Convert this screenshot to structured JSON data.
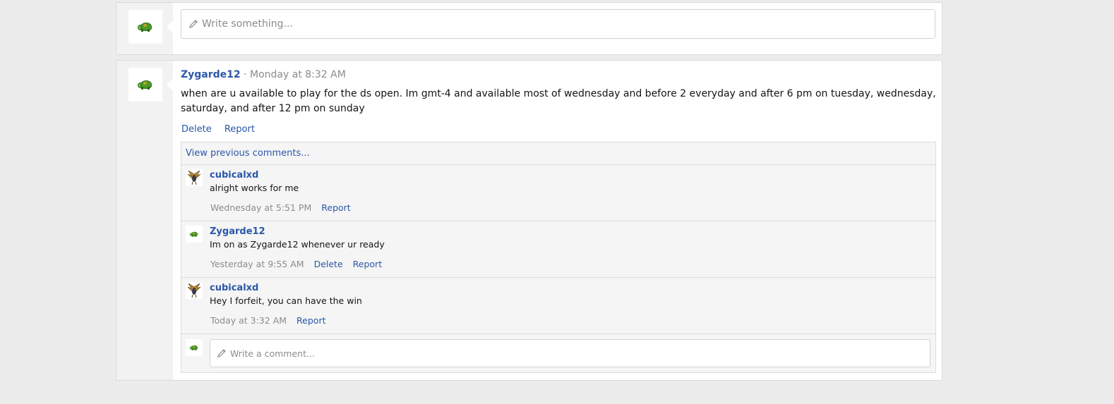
{
  "composer": {
    "placeholder": "Write something..."
  },
  "post": {
    "author": "Zygarde12",
    "separator": " · ",
    "time": "Monday at 8:32 AM",
    "body": "when are u available to play for the ds open. Im gmt-4 and available most of wednesday and before 2 everyday and after 6 pm on tuesday, wednesday, saturday, and after 12 pm on sunday",
    "actions": {
      "delete": "Delete",
      "report": "Report"
    }
  },
  "comments": {
    "view_previous": "View previous comments...",
    "items": [
      {
        "author": "cubicalxd",
        "avatar": "bird-avatar",
        "text": "alright works for me",
        "time": "Wednesday at 5:51 PM",
        "delete": "",
        "report": "Report"
      },
      {
        "author": "Zygarde12",
        "avatar": "turtle-avatar",
        "text": "Im on as Zygarde12 whenever ur ready",
        "time": "Yesterday at 9:55 AM",
        "delete": "Delete",
        "report": "Report"
      },
      {
        "author": "cubicalxd",
        "avatar": "bird-avatar",
        "text": "Hey I forfeit, you can have the win",
        "time": "Today at 3:32 AM",
        "delete": "",
        "report": "Report"
      }
    ],
    "reply_placeholder": "Write a comment..."
  },
  "colors": {
    "link": "#2a57a8",
    "muted": "#8c8c8c",
    "page_bg": "#ececec",
    "sidebar_bg": "#f2f2f2"
  }
}
